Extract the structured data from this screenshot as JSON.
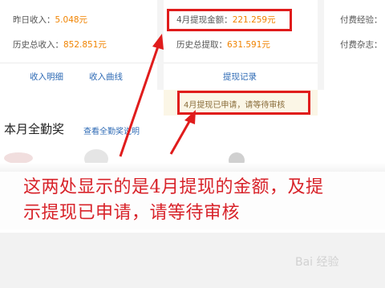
{
  "income_panel": {
    "yesterday_label": "昨日收入：",
    "yesterday_value": "5.048元",
    "total_label": "历史总收入：",
    "total_value": "852.851元",
    "link_detail": "收入明细",
    "link_curve": "收入曲线"
  },
  "withdraw_panel": {
    "april_label": "4月提现金额：",
    "april_value": "221.259元",
    "history_label": "历史总提取：",
    "history_value": "631.591元",
    "link_records": "提现记录",
    "notice": "4月提现已申请，请等待审核"
  },
  "paid_panel": {
    "experience_label": "付费经验：",
    "magazine_label": "付费杂志："
  },
  "attendance": {
    "title": "本月全勤奖",
    "link": "查看全勤奖说明"
  },
  "annotation": {
    "line1": "这两处显示的是4月提现的金额，及提",
    "line2": "示提现已申请，请等待审核"
  },
  "watermark": {
    "text": "Bai 经验"
  },
  "colors": {
    "accent_number": "#f08300",
    "link_blue": "#2f6bb5",
    "annotation_red": "#e01c1c",
    "notice_bg": "#fbf6e6"
  }
}
